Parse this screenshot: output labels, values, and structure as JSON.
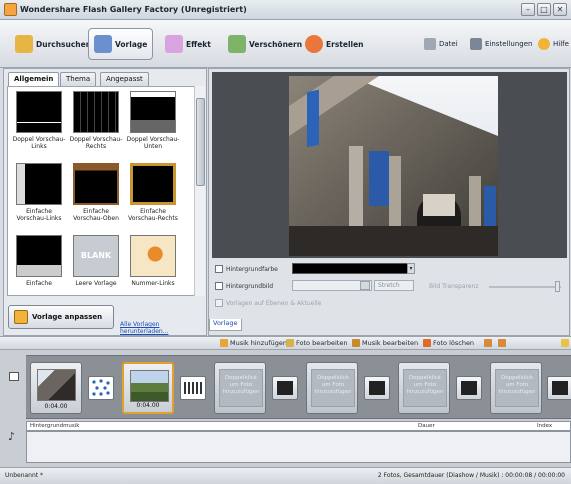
{
  "window": {
    "title": "Wondershare Flash Gallery Factory (Unregistriert)",
    "controls": [
      "–",
      "□",
      "✕"
    ]
  },
  "toolbar": {
    "steps": [
      {
        "label": "Durchsuchen",
        "icon": "folder-icon",
        "color": "#e8b443"
      },
      {
        "label": "Vorlage",
        "icon": "pencil-icon",
        "color": "#6c8fd0"
      },
      {
        "label": "Effekt",
        "icon": "sparkle-icon",
        "color": "#d9a3e0"
      },
      {
        "label": "Verschönern",
        "icon": "checkmark-pencil-icon",
        "color": "#7fb36a"
      },
      {
        "label": "Erstellen",
        "icon": "create-disc-icon",
        "color": "#e9763a"
      }
    ],
    "links": [
      {
        "label": "Datei",
        "icon": "file-icon",
        "color": "#a0a8b3"
      },
      {
        "label": "Einstellungen",
        "icon": "settings-icon",
        "color": "#7b8796"
      },
      {
        "label": "Hilfe",
        "icon": "help-icon",
        "color": "#f0b43a"
      }
    ]
  },
  "left": {
    "tabs": [
      "Allgemein",
      "Thema",
      "Angepasst"
    ],
    "templates": [
      {
        "caption": "Doppel Vorschau-Links"
      },
      {
        "caption": "Doppel Vorschau-Rechts"
      },
      {
        "caption": "Doppel Vorschau-Unten"
      },
      {
        "caption": "Einfache Vorschau-Links"
      },
      {
        "caption": "Einfache Vorschau-Oben"
      },
      {
        "caption": "Einfache Vorschau-Rechts"
      },
      {
        "caption": "Einfache"
      },
      {
        "caption": "Leere Vorlage",
        "placeholder": "BLANK"
      },
      {
        "caption": "Nummer-Links"
      }
    ],
    "customize_button": "Vorlage anpassen",
    "download_link": "Alle Vorlagen herunterladen..."
  },
  "right": {
    "bg_color_label": "Hintergrundfarbe",
    "bg_image_label": "Hintergrundbild",
    "stretch_value": "Stretch",
    "transparency_label": "Bild Transparenz",
    "apply_all_label": "Vorlagen auf Ebenen & Aktuelle",
    "panel_tab": "Vorlage"
  },
  "timeline": {
    "tools": [
      "Musik hinzufügen",
      "Foto bearbeiten",
      "Musik bearbeiten",
      "Foto löschen"
    ],
    "photos": [
      {
        "duration": "0:04.00"
      },
      {
        "duration": "0:04.00"
      }
    ],
    "dropzone_text": "Doppelklick um Foto hinzuzufügen",
    "music_header": {
      "track": "Hintergrundmusik",
      "duration": "Dauer",
      "index": "Index"
    }
  },
  "status": {
    "left": "Unbenannt *",
    "right": "2 Fotos, Gesamtdauer (Diashow / Musik) : 00:00:08 / 00:00:00"
  }
}
